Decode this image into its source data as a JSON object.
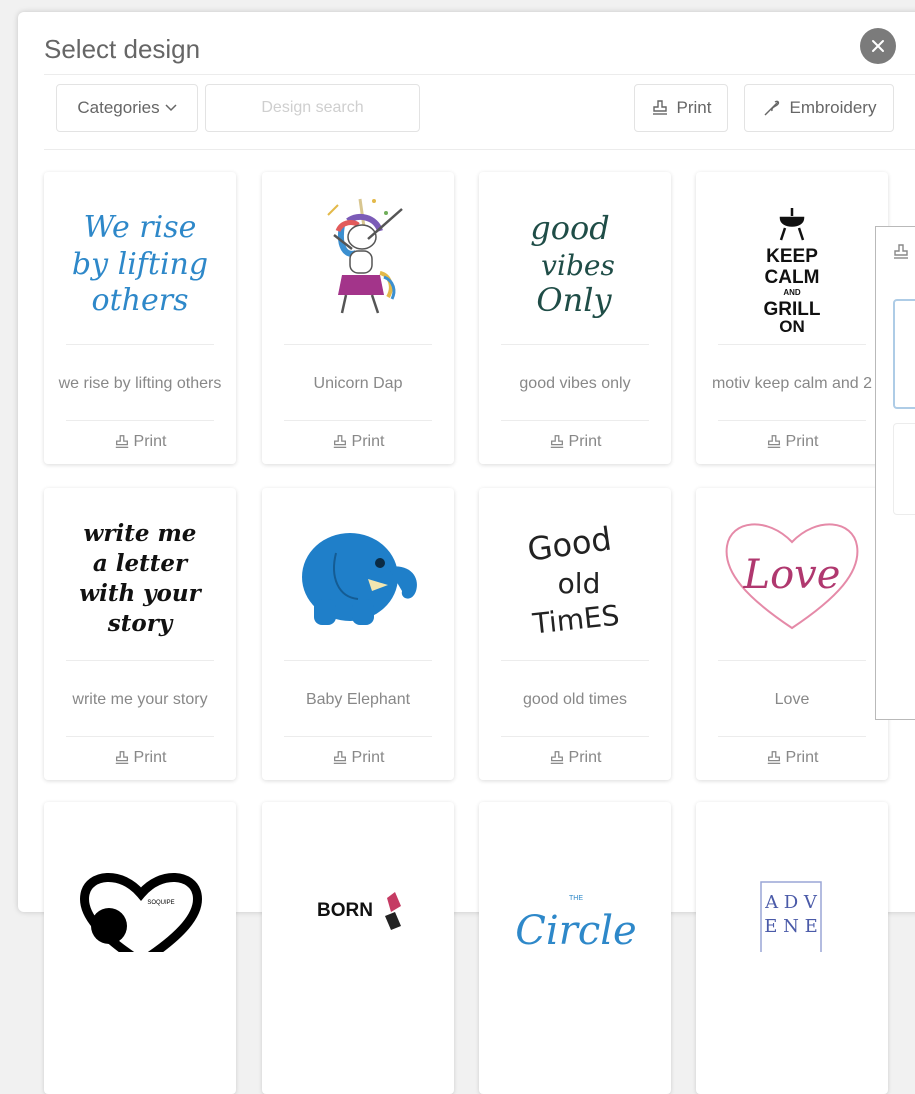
{
  "dialog": {
    "title": "Select design",
    "close_icon": "close-icon"
  },
  "toolbar": {
    "categories_label": "Categories",
    "search_placeholder": "Design search",
    "print_label": "Print",
    "embroidery_label": "Embroidery"
  },
  "designs": [
    {
      "title": "we rise by lifting others",
      "action": "Print",
      "art": [
        "We rise",
        "by lifting",
        "others"
      ]
    },
    {
      "title": "Unicorn Dap",
      "action": "Print"
    },
    {
      "title": "good vibes only",
      "action": "Print",
      "art": [
        "good",
        "vibes",
        "Only"
      ]
    },
    {
      "title": "motiv keep calm and 2",
      "action": "Print",
      "art": [
        "KEEP",
        "CALM",
        "AND",
        "GRILL",
        "ON"
      ]
    },
    {
      "title": "write me your story",
      "action": "Print",
      "art": [
        "write me",
        "a letter",
        "with your",
        "story"
      ]
    },
    {
      "title": "Baby Elephant",
      "action": "Print"
    },
    {
      "title": "good old times",
      "action": "Print",
      "art": [
        "Good",
        "old",
        "TimES"
      ]
    },
    {
      "title": "Love",
      "action": "Print",
      "art": [
        "Love"
      ]
    },
    {
      "title": "",
      "action": "",
      "art": [
        "SOQUIPE"
      ]
    },
    {
      "title": "",
      "action": "",
      "art": [
        "BORN"
      ]
    },
    {
      "title": "",
      "action": "",
      "art": [
        "THE",
        "Circle"
      ]
    },
    {
      "title": "",
      "action": "",
      "art": [
        "A D V",
        "E N E"
      ]
    }
  ],
  "colors": {
    "accent_blue": "#2e88c9",
    "dark_green": "#1f4d47",
    "love_pink": "#b0386f"
  }
}
